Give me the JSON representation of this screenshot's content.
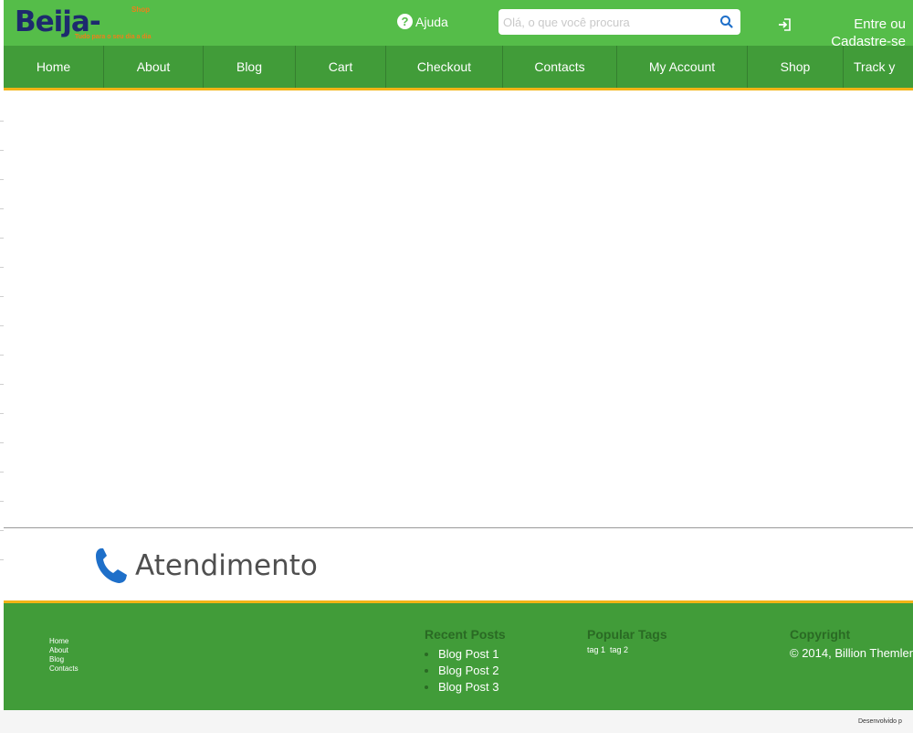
{
  "header": {
    "logo_text": "Beija-flor",
    "logo_tagline": "Tudo para o seu dia a dia",
    "logo_sup": "Shop",
    "help_label": "Ajuda",
    "search_placeholder": "Olá, o que você procura",
    "login_label": "Entre ou Cadastre-se"
  },
  "nav": {
    "items": [
      "Home",
      "About",
      "Blog",
      "Cart",
      "Checkout",
      "Contacts",
      "My Account",
      "Shop",
      "Track y"
    ]
  },
  "atendimento": {
    "title": "Atendimento"
  },
  "footer": {
    "links": [
      "Home",
      "About",
      "Blog",
      "Contacts"
    ],
    "recent_posts_title": "Recent Posts",
    "recent_posts": [
      "Blog Post 1",
      "Blog Post 2",
      "Blog Post 3"
    ],
    "popular_tags_title": "Popular Tags",
    "tags": [
      "tag 1",
      "tag 2"
    ],
    "copyright_title": "Copyright",
    "copyright_text": "© 2014, Billion Themler"
  },
  "bottom": {
    "dev_credit": "Desenvolvido p"
  },
  "colors": {
    "header_green": "#55bd49",
    "nav_green": "#419c39",
    "accent_yellow": "#f2b416",
    "logo_navy": "#1d2a6e",
    "logo_orange": "#ef7f1a",
    "phone_blue": "#1e6fc9"
  },
  "icons": {
    "help": "question-circle-icon",
    "search": "search-icon",
    "login": "sign-in-icon",
    "atendimento": "phone-icon"
  }
}
